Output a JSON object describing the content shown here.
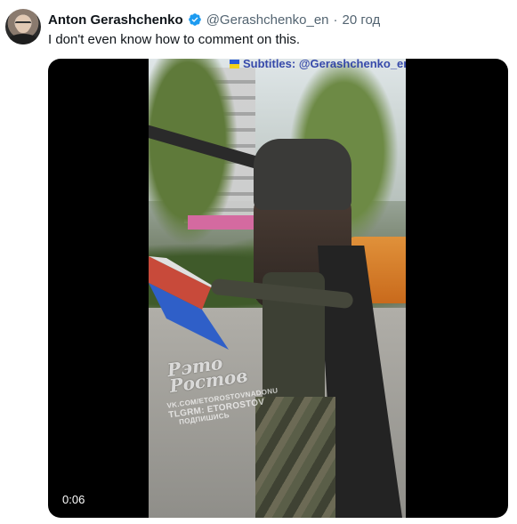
{
  "tweet": {
    "author_name": "Anton Gerashchenko",
    "handle": "@Gerashchenko_en",
    "separator": "·",
    "time": "20 год",
    "text": "I don't even know how to comment on this.",
    "verified_color": "#1d9bf0"
  },
  "video": {
    "subtitle_watermark": "Subtitles: @Gerashchenko_en",
    "watermark_title_line1": "Ρэто",
    "watermark_title_line2": "Ростов",
    "watermark_line1": "VK.COM/ETOROSTOVNADONU",
    "watermark_line2": "TLGRM: ETOROSTOV",
    "watermark_line3": "ПОДПИШИСЬ",
    "timestamp": "0:06"
  }
}
